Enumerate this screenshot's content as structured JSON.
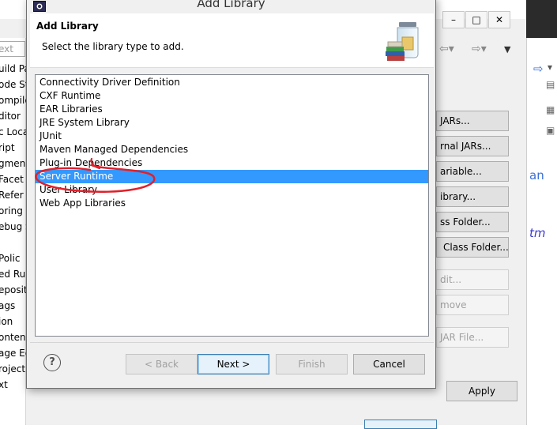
{
  "dialog": {
    "title": "Add Library",
    "header_title": "Add Library",
    "header_description": "Select the library type to add.",
    "libraries": [
      "Connectivity Driver Definition",
      "CXF Runtime",
      "EAR Libraries",
      "JRE System Library",
      "JUnit",
      "Maven Managed Dependencies",
      "Plug-in Dependencies",
      "Server Runtime",
      "User Library",
      "Web App Libraries"
    ],
    "selected_library": "Server Runtime",
    "buttons": {
      "help": "?",
      "back": "< Back",
      "next": "Next >",
      "finish": "Finish",
      "cancel": "Cancel"
    }
  },
  "background": {
    "filter_placeholder": "ext",
    "left_items": [
      "uild Pa",
      "ode St",
      "ompile",
      "ditor",
      "c Loca",
      "ript",
      "gmen",
      "Facet",
      "Refer",
      "oring",
      "ebug S",
      "",
      "Polic",
      "ed Ru",
      "eposit",
      "ags",
      "ion",
      "onten",
      "age Ed",
      "roject",
      "xt"
    ],
    "right_buttons": [
      "JARs...",
      "rnal JARs...",
      "ariable...",
      "ibrary...",
      "ss Folder...",
      "Class Folder...",
      "dit...",
      "move",
      "JAR File..."
    ],
    "apply": "Apply",
    "code_fragments": [
      "an",
      "tm"
    ]
  },
  "colors": {
    "selection": "#3399ff",
    "annotation": "#e0202a"
  },
  "icons": {
    "app": "eclipse-icon",
    "header": "library-jars-icon"
  }
}
